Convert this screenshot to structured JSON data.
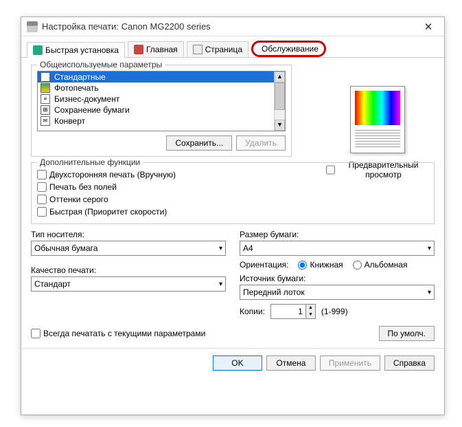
{
  "title": "Настройка печати: Canon MG2200 series",
  "tabs": {
    "quick": "Быстрая установка",
    "main": "Главная",
    "page": "Страница",
    "maint": "Обслуживание"
  },
  "groups": {
    "common": "Общеиспользуемые параметры",
    "addl": "Дополнительные функции"
  },
  "presets": {
    "standard": "Стандартные",
    "photo": "Фотопечать",
    "business": "Бизнес-документ",
    "paper_save": "Сохранение бумаги",
    "envelope": "Конверт"
  },
  "buttons": {
    "save": "Сохранить...",
    "delete": "Удалить",
    "defaults": "По умолч.",
    "ok": "OK",
    "cancel": "Отмена",
    "apply": "Применить",
    "help": "Справка"
  },
  "preview_check": "Предварительный просмотр",
  "addl": {
    "duplex": "Двухсторонняя печать (Вручную)",
    "borderless": "Печать без полей",
    "grayscale": "Оттенки серого",
    "fast": "Быстрая (Приоритет скорости)"
  },
  "media": {
    "label": "Тип носителя:",
    "value": "Обычная бумага"
  },
  "quality": {
    "label": "Качество печати:",
    "value": "Стандарт"
  },
  "paper": {
    "label": "Размер бумаги:",
    "value": "A4"
  },
  "orientation": {
    "label": "Ориентация:",
    "portrait": "Книжная",
    "landscape": "Альбомная"
  },
  "source": {
    "label": "Источник бумаги:",
    "value": "Передний лоток"
  },
  "copies": {
    "label": "Копии:",
    "value": "1",
    "range": "(1-999)"
  },
  "always": "Всегда печатать с текущими параметрами"
}
